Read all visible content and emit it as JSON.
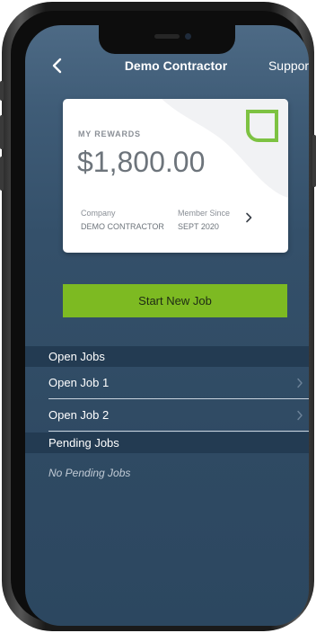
{
  "navbar": {
    "back_icon": "chevron-left-icon",
    "title": "Demo Contractor",
    "support_label": "Support"
  },
  "rewards_card": {
    "label": "MY REWARDS",
    "balance": "$1,800.00",
    "company_label": "Company",
    "company_value": "DEMO CONTRACTOR",
    "member_since_label": "Member Since",
    "member_since_value": "SEPT 2020",
    "logo_color": "#7dc242",
    "chevron_icon": "chevron-right-icon"
  },
  "start_job_button": {
    "label": "Start New Job",
    "color": "#7dba22"
  },
  "open_jobs": {
    "header": "Open Jobs",
    "items": [
      {
        "label": "Open Job 1"
      },
      {
        "label": "Open Job 2"
      }
    ]
  },
  "pending_jobs": {
    "header": "Pending Jobs",
    "empty_text": "No Pending Jobs"
  },
  "theme": {
    "background": "#34506a",
    "section_header_bg": "#233b52",
    "accent": "#7dba22"
  }
}
